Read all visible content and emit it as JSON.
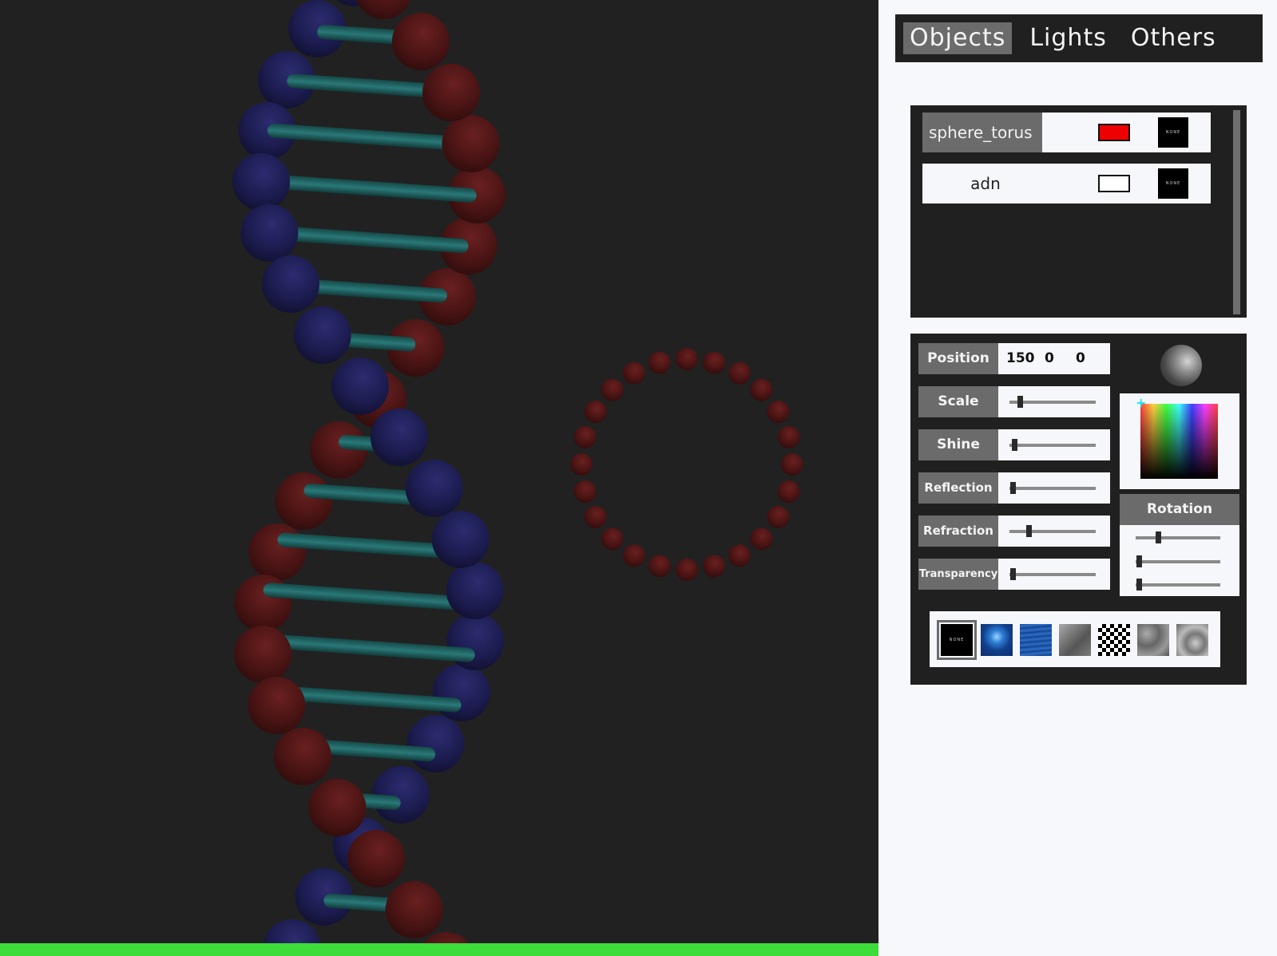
{
  "tabs": [
    {
      "label": "Objects",
      "active": true
    },
    {
      "label": "Lights",
      "active": false
    },
    {
      "label": "Others",
      "active": false
    }
  ],
  "objects": [
    {
      "name": "sphere_torus",
      "color": "#ee0000",
      "texture_label": "NONE",
      "selected": true
    },
    {
      "name": "adn",
      "color": "#ffffff",
      "texture_label": "NONE",
      "selected": false
    }
  ],
  "properties": {
    "position": {
      "label": "Position",
      "x": "150",
      "y": "0",
      "z": "0"
    },
    "scale": {
      "label": "Scale",
      "value": 0.12
    },
    "shine": {
      "label": "Shine",
      "value": 0.06
    },
    "reflection": {
      "label": "Reflection",
      "value": 0.04
    },
    "refraction": {
      "label": "Refraction",
      "value": 0.22
    },
    "transparency": {
      "label": "Transparency",
      "value": 0.04
    }
  },
  "rotation": {
    "label": "Rotation",
    "values": [
      0.26,
      0.04,
      0.04
    ]
  },
  "textures": [
    {
      "name": "none",
      "label": "NONE",
      "selected": true
    },
    {
      "name": "ripple",
      "selected": false
    },
    {
      "name": "water",
      "selected": false
    },
    {
      "name": "stone",
      "selected": false
    },
    {
      "name": "checker",
      "selected": false
    },
    {
      "name": "noise-dark",
      "selected": false
    },
    {
      "name": "noise-light",
      "selected": false
    }
  ],
  "render_progress": 1.0,
  "colors": {
    "viewport_bg": "#212121",
    "panel_bg": "#f7f8fc",
    "dark_box": "#202020",
    "label_bg": "#6b6b6b",
    "progress": "#3ddc3a",
    "dna_red": "#4a1414",
    "dna_blue": "#1a1a4a",
    "dna_rung": "#1f5d5d"
  }
}
